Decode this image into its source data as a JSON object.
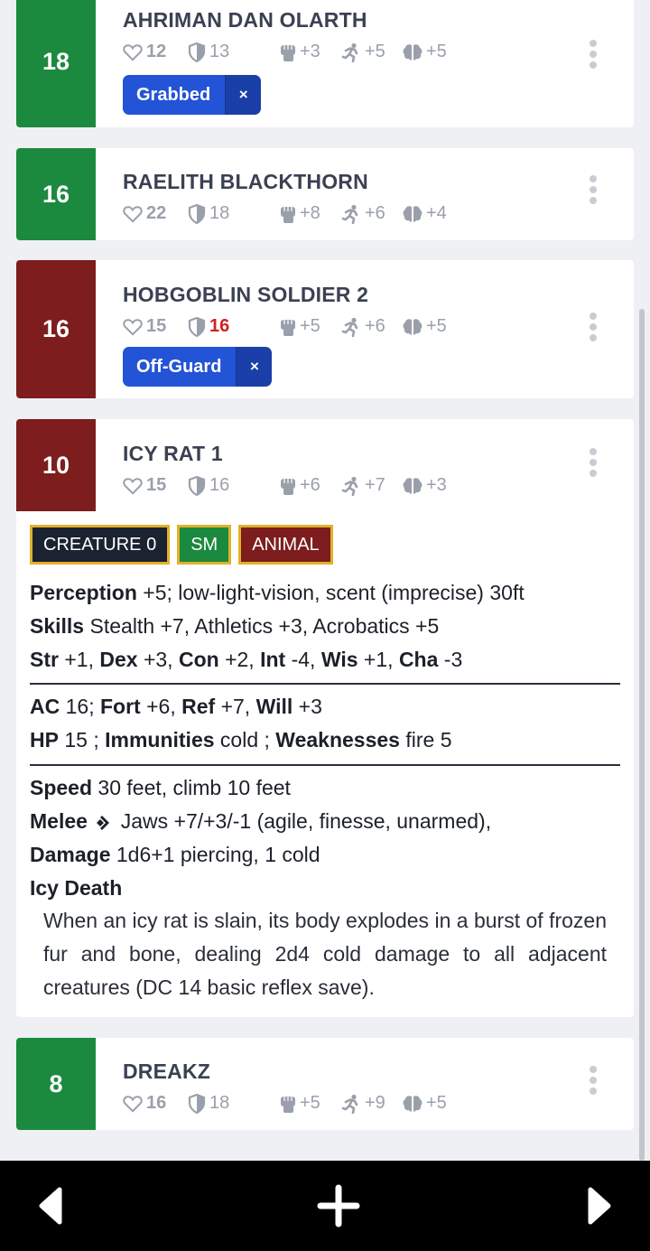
{
  "combatants": [
    {
      "initiative": "18",
      "name": "AHRIMAN DAN OLARTH",
      "hp": "12",
      "ac": "13",
      "fort": "+3",
      "ref": "+5",
      "will": "+5",
      "conditions": [
        {
          "label": "Grabbed",
          "remove": "×"
        }
      ]
    },
    {
      "initiative": "16",
      "name": "RAELITH BLACKTHORN",
      "hp": "22",
      "ac": "18",
      "fort": "+8",
      "ref": "+6",
      "will": "+4"
    },
    {
      "initiative": "16",
      "name": "HOBGOBLIN SOLDIER 2",
      "hp": "15",
      "ac": "16",
      "fort": "+5",
      "ref": "+6",
      "will": "+5",
      "conditions": [
        {
          "label": "Off-Guard",
          "remove": "×"
        }
      ]
    },
    {
      "initiative": "10",
      "name": "ICY RAT 1",
      "hp": "15",
      "ac": "16",
      "fort": "+6",
      "ref": "+7",
      "will": "+3",
      "traits": [
        "CREATURE 0",
        "SM",
        "ANIMAL"
      ],
      "statblock": {
        "perception_label": "Perception",
        "perception_value": " +5; low-light-vision, scent (imprecise) 30ft",
        "skills_label": "Skills",
        "skills_value": " Stealth +7, Athletics +3, Acrobatics +5",
        "str_label": "Str",
        "str_value": " +1, ",
        "dex_label": "Dex",
        "dex_value": " +3, ",
        "con_label": "Con",
        "con_value": " +2, ",
        "int_label": "Int",
        "int_value": " -4, ",
        "wis_label": "Wis",
        "wis_value": " +1, ",
        "cha_label": "Cha",
        "cha_value": " -3",
        "ac_label": "AC",
        "ac_value": " 16; ",
        "fort_label": "Fort",
        "fort_value": " +6, ",
        "ref_label": "Ref",
        "ref_value": " +7, ",
        "will_label": "Will",
        "will_value": " +3",
        "hp_label": "HP",
        "hp_value": " 15 ; ",
        "immunities_label": "Immunities",
        "immunities_value": " cold ; ",
        "weaknesses_label": "Weaknesses",
        "weaknesses_value": " fire 5",
        "speed_label": "Speed",
        "speed_value": " 30 feet, climb 10 feet",
        "melee_label": "Melee",
        "melee_value": " Jaws +7/+3/-1 (agile, finesse, unarmed),",
        "damage_label": "Damage",
        "damage_value": " 1d6+1 piercing, 1 cold",
        "ability_name": "Icy Death",
        "ability_text": "When an icy rat is slain, its body explodes in a burst of frozen fur and bone, dealing 2d4 cold damage to all adjacent creatures (DC 14 basic reflex save)."
      }
    },
    {
      "initiative": "8",
      "name": "DREAKZ",
      "hp": "16",
      "ac": "18",
      "fort": "+5",
      "ref": "+9",
      "will": "+5"
    }
  ],
  "icons": {
    "hp": "heart-icon",
    "ac": "shield-icon",
    "fort": "fist-icon",
    "ref": "running-icon",
    "will": "brain-icon",
    "menu": "kebab-menu-icon",
    "action": "one-action-icon",
    "nav_prev": "triangle-left-icon",
    "nav_add": "plus-icon",
    "nav_next": "triangle-right-icon"
  },
  "colors": {
    "ally": "#1b8a3e",
    "enemy": "#7d1d1d",
    "condition": "#2353d6",
    "trait_border": "#e0b22a",
    "alert": "#d32020"
  }
}
